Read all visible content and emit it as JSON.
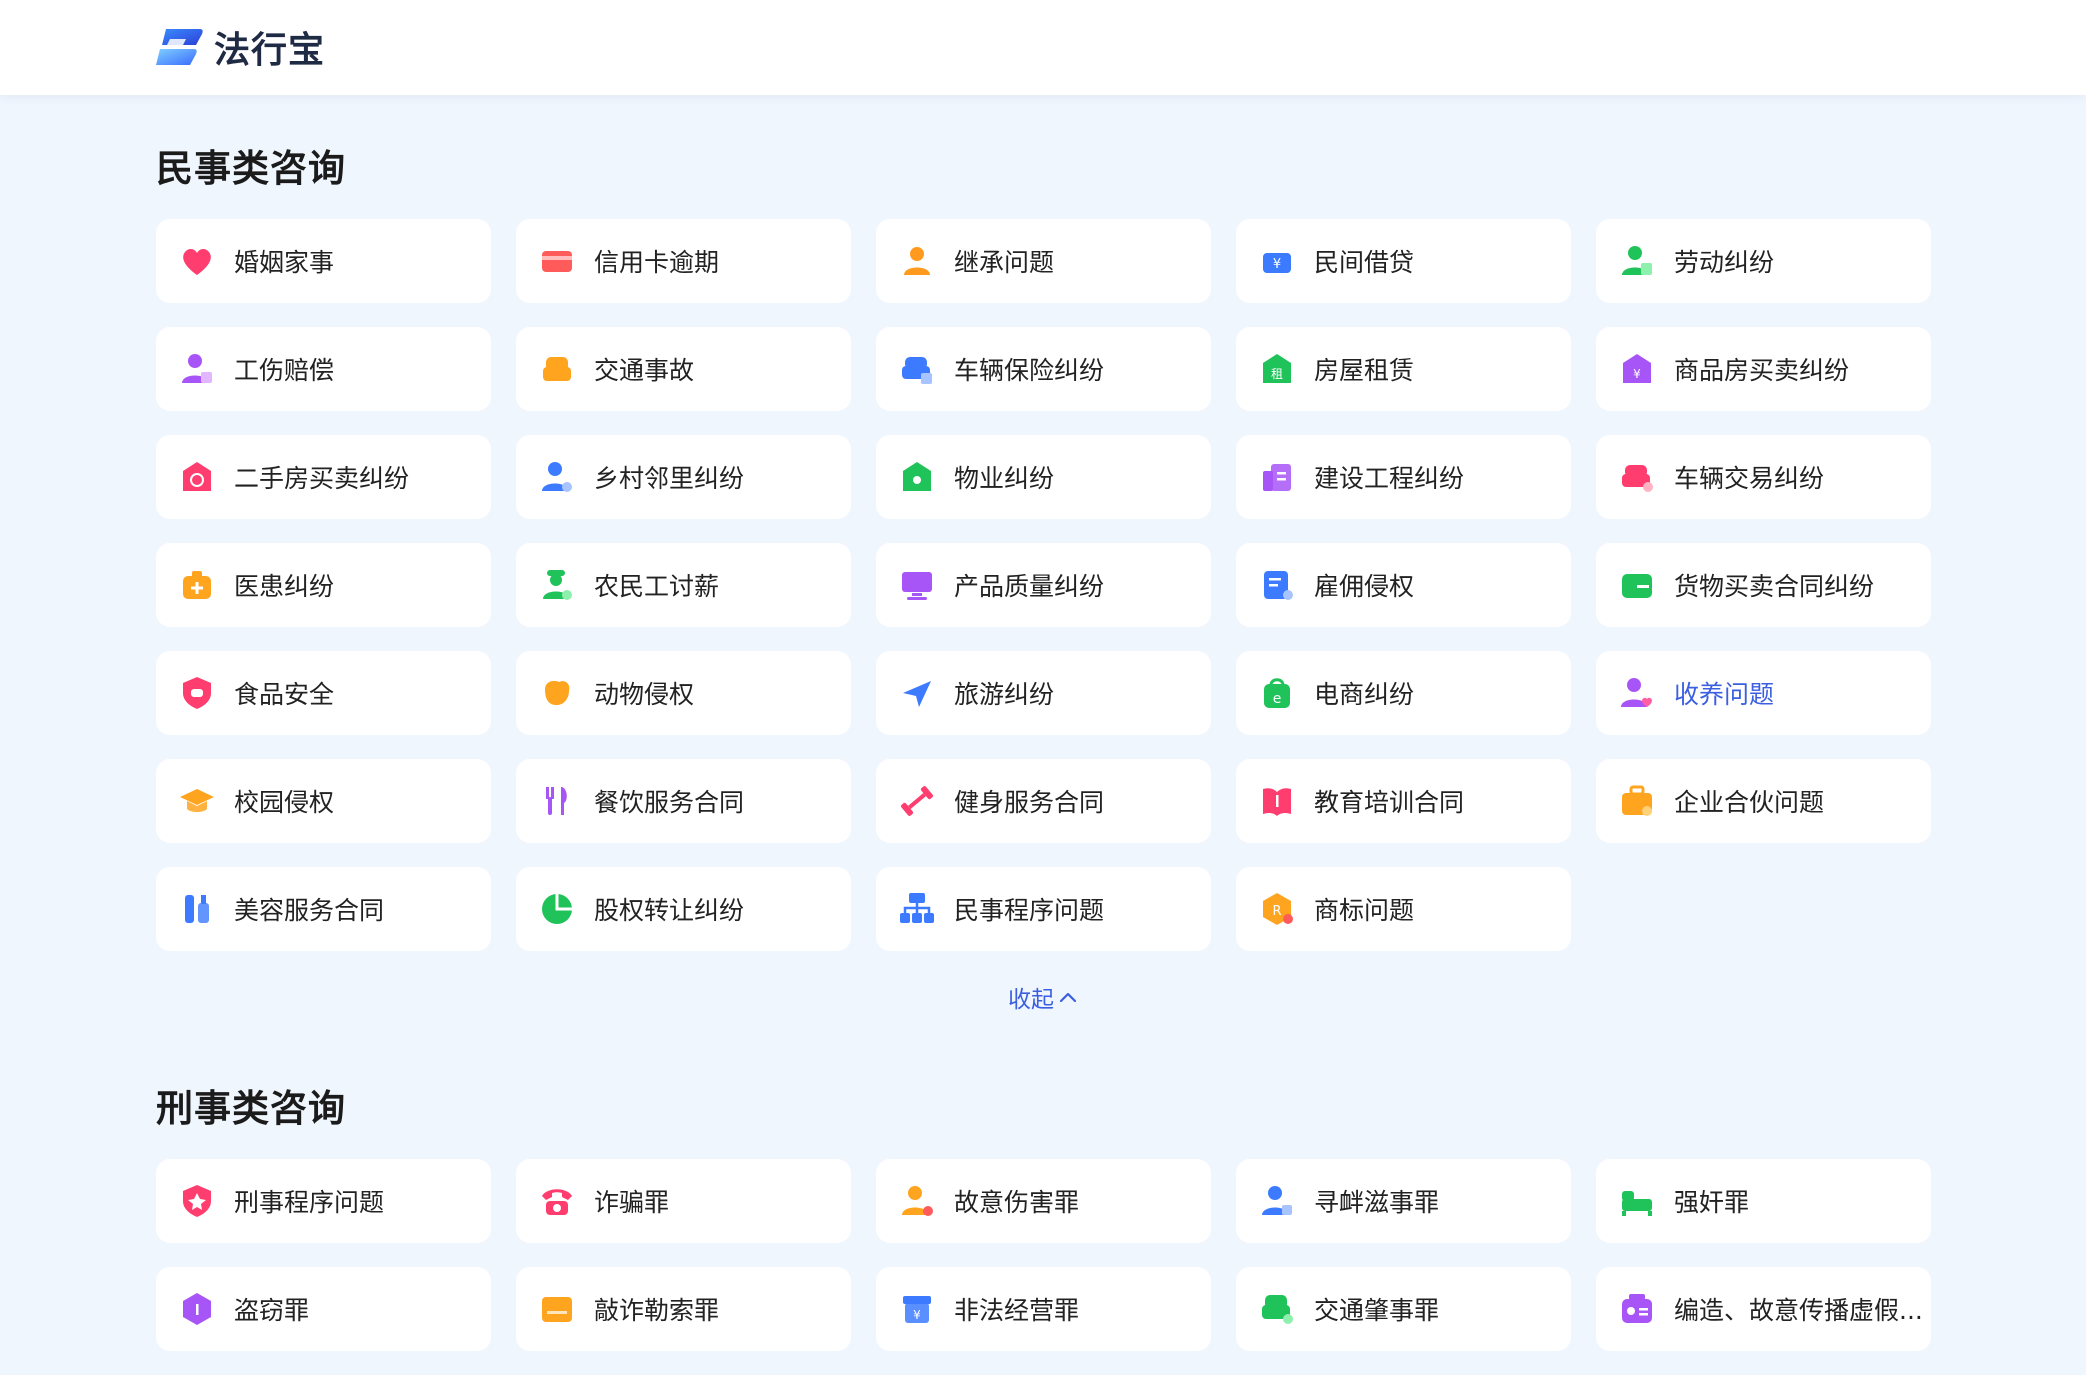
{
  "brand": {
    "name": "法行宝"
  },
  "civil": {
    "title": "民事类咨询",
    "items": [
      {
        "label": "婚姻家事",
        "icon": "heart-icon",
        "color": "#ff3d6e"
      },
      {
        "label": "信用卡逾期",
        "icon": "credit-card-icon",
        "color": "#ff5b5b"
      },
      {
        "label": "继承问题",
        "icon": "person-icon",
        "color": "#ff9a1f"
      },
      {
        "label": "民间借贷",
        "icon": "money-icon",
        "color": "#3c7bff"
      },
      {
        "label": "劳动纠纷",
        "icon": "worker-icon",
        "color": "#20c35a"
      },
      {
        "label": "工伤赔偿",
        "icon": "injured-person-icon",
        "color": "#a855f7"
      },
      {
        "label": "交通事故",
        "icon": "car-icon",
        "color": "#ffa41f"
      },
      {
        "label": "车辆保险纠纷",
        "icon": "car-insurance-icon",
        "color": "#3c7bff"
      },
      {
        "label": "房屋租赁",
        "icon": "rent-icon",
        "color": "#20c35a"
      },
      {
        "label": "商品房买卖纠纷",
        "icon": "house-price-icon",
        "color": "#a855f7"
      },
      {
        "label": "二手房买卖纠纷",
        "icon": "house-exchange-icon",
        "color": "#ff3d6e"
      },
      {
        "label": "乡村邻里纠纷",
        "icon": "neighbor-icon",
        "color": "#3c7bff"
      },
      {
        "label": "物业纠纷",
        "icon": "property-icon",
        "color": "#20c35a"
      },
      {
        "label": "建设工程纠纷",
        "icon": "building-icon",
        "color": "#a855f7"
      },
      {
        "label": "车辆交易纠纷",
        "icon": "car-trade-icon",
        "color": "#ff3d6e"
      },
      {
        "label": "医患纠纷",
        "icon": "medical-kit-icon",
        "color": "#ffa41f"
      },
      {
        "label": "农民工讨薪",
        "icon": "farmer-icon",
        "color": "#20c35a"
      },
      {
        "label": "产品质量纠纷",
        "icon": "monitor-icon",
        "color": "#a855f7"
      },
      {
        "label": "雇佣侵权",
        "icon": "employment-icon",
        "color": "#3c7bff"
      },
      {
        "label": "货物买卖合同纠纷",
        "icon": "wallet-icon",
        "color": "#20c35a"
      },
      {
        "label": "食品安全",
        "icon": "food-shield-icon",
        "color": "#ff3d6e"
      },
      {
        "label": "动物侵权",
        "icon": "animal-icon",
        "color": "#ffa41f"
      },
      {
        "label": "旅游纠纷",
        "icon": "plane-icon",
        "color": "#3c7bff"
      },
      {
        "label": "电商纠纷",
        "icon": "shopping-bag-icon",
        "color": "#20c35a"
      },
      {
        "label": "收养问题",
        "icon": "adoption-icon",
        "color": "#a855f7"
      },
      {
        "label": "校园侵权",
        "icon": "graduation-cap-icon",
        "color": "#ffa41f"
      },
      {
        "label": "餐饮服务合同",
        "icon": "fork-knife-icon",
        "color": "#a855f7"
      },
      {
        "label": "健身服务合同",
        "icon": "dumbbell-icon",
        "color": "#ff3d6e"
      },
      {
        "label": "教育培训合同",
        "icon": "book-icon",
        "color": "#ff3d6e"
      },
      {
        "label": "企业合伙问题",
        "icon": "briefcase-icon",
        "color": "#ffa41f"
      },
      {
        "label": "美容服务合同",
        "icon": "cosmetics-icon",
        "color": "#3c7bff"
      },
      {
        "label": "股权转让纠纷",
        "icon": "pie-chart-icon",
        "color": "#20c35a"
      },
      {
        "label": "民事程序问题",
        "icon": "hierarchy-icon",
        "color": "#3c7bff"
      },
      {
        "label": "商标问题",
        "icon": "trademark-icon",
        "color": "#ffa41f"
      }
    ],
    "active_label": "收养问题",
    "collapse_label": "收起"
  },
  "criminal": {
    "title": "刑事类咨询",
    "items": [
      {
        "label": "刑事程序问题",
        "icon": "police-shield-icon",
        "color": "#ff3d6e"
      },
      {
        "label": "诈骗罪",
        "icon": "phone-icon",
        "color": "#ff3d6e"
      },
      {
        "label": "故意伤害罪",
        "icon": "person-alert-icon",
        "color": "#ffa41f"
      },
      {
        "label": "寻衅滋事罪",
        "icon": "person-flag-icon",
        "color": "#3c7bff"
      },
      {
        "label": "强奸罪",
        "icon": "bed-icon",
        "color": "#20c35a"
      },
      {
        "label": "盗窃罪",
        "icon": "gem-icon",
        "color": "#a855f7"
      },
      {
        "label": "敲诈勒索罪",
        "icon": "money-note-icon",
        "color": "#ffa41f"
      },
      {
        "label": "非法经营罪",
        "icon": "shop-yen-icon",
        "color": "#3c7bff"
      },
      {
        "label": "交通肇事罪",
        "icon": "car-crash-icon",
        "color": "#20c35a"
      },
      {
        "label": "编造、故意传播虚假...",
        "icon": "radio-icon",
        "color": "#a855f7"
      }
    ]
  }
}
